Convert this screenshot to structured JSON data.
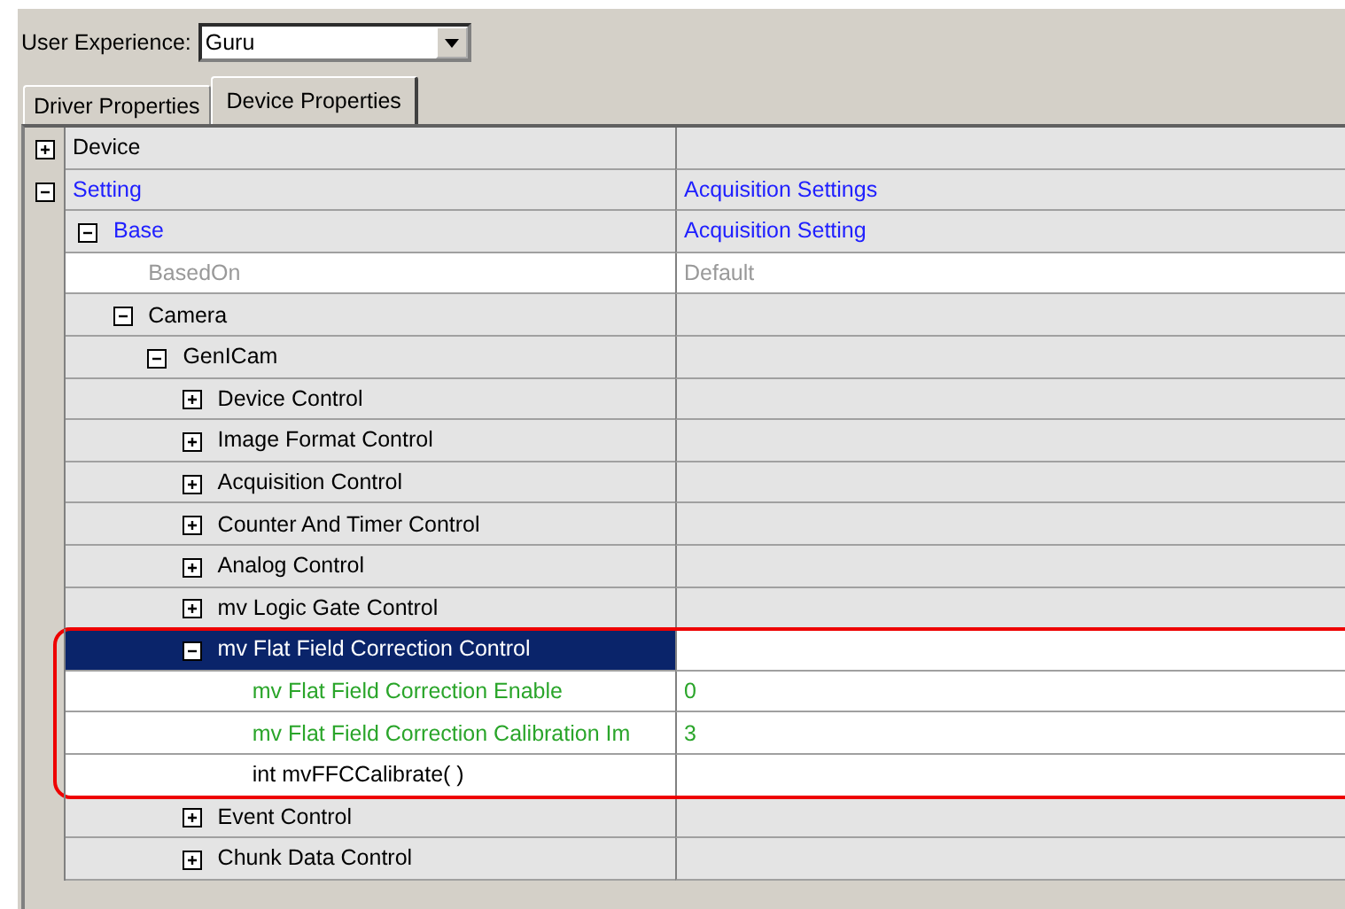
{
  "user_experience": {
    "label": "User Experience:",
    "value": "Guru"
  },
  "tabs": [
    {
      "label": "Driver Properties",
      "selected": false
    },
    {
      "label": "Device Properties",
      "selected": true
    }
  ],
  "tree": [
    {
      "name": "Device",
      "kind": "category",
      "expanded": false,
      "selected": false,
      "highlighted": false
    },
    {
      "name": "Setting",
      "value": "Acquisition Settings",
      "kind": "setting",
      "expanded": true,
      "selected": false,
      "highlighted": false,
      "children": [
        {
          "name": "Base",
          "value": "Acquisition Setting",
          "kind": "setting",
          "expanded": true,
          "selected": false,
          "highlighted": false,
          "children": [
            {
              "name": "BasedOn",
              "value": "Default",
              "kind": "readonly",
              "selected": false,
              "highlighted": false
            },
            {
              "name": "Camera",
              "kind": "category",
              "expanded": true,
              "selected": false,
              "highlighted": false,
              "children": [
                {
                  "name": "GenICam",
                  "kind": "category",
                  "expanded": true,
                  "selected": false,
                  "highlighted": false,
                  "children": [
                    {
                      "name": "Device Control",
                      "kind": "category",
                      "expanded": false,
                      "selected": false,
                      "highlighted": false
                    },
                    {
                      "name": "Image Format Control",
                      "kind": "category",
                      "expanded": false,
                      "selected": false,
                      "highlighted": false
                    },
                    {
                      "name": "Acquisition Control",
                      "kind": "category",
                      "expanded": false,
                      "selected": false,
                      "highlighted": false
                    },
                    {
                      "name": "Counter And Timer Control",
                      "kind": "category",
                      "expanded": false,
                      "selected": false,
                      "highlighted": false
                    },
                    {
                      "name": "Analog Control",
                      "kind": "category",
                      "expanded": false,
                      "selected": false,
                      "highlighted": false
                    },
                    {
                      "name": "mv Logic Gate Control",
                      "kind": "category",
                      "expanded": false,
                      "selected": false,
                      "highlighted": false
                    },
                    {
                      "name": "mv Flat Field Correction Control",
                      "kind": "category",
                      "expanded": true,
                      "selected": true,
                      "highlighted": true,
                      "children": [
                        {
                          "name": "mv Flat Field Correction Enable",
                          "value": "0",
                          "kind": "property",
                          "selected": false,
                          "highlighted": false
                        },
                        {
                          "name": "mv Flat Field Correction Calibration Im",
                          "value": "3",
                          "kind": "property",
                          "selected": false,
                          "highlighted": false
                        },
                        {
                          "name": "int mvFFCCalibrate( )",
                          "kind": "method",
                          "selected": false,
                          "highlighted": false
                        }
                      ]
                    },
                    {
                      "name": "Event Control",
                      "kind": "category",
                      "expanded": false,
                      "selected": false,
                      "highlighted": false
                    },
                    {
                      "name": "Chunk Data Control",
                      "kind": "category",
                      "expanded": false,
                      "selected": false,
                      "highlighted": false
                    }
                  ]
                }
              ]
            }
          ]
        }
      ]
    }
  ]
}
